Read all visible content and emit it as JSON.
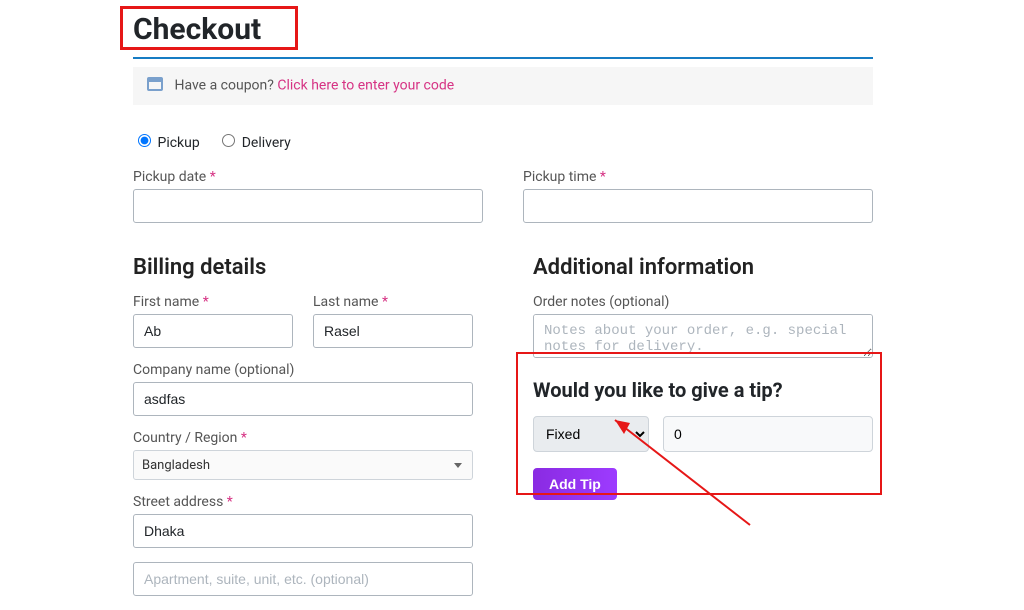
{
  "page": {
    "title": "Checkout"
  },
  "coupon": {
    "lead": "Have a coupon?",
    "link": "Click here to enter your code"
  },
  "selection": {
    "pickup_label": "Pickup",
    "delivery_label": "Delivery"
  },
  "schedule": {
    "pickup_date_label": "Pickup date",
    "pickup_time_label": "Pickup time",
    "pickup_date_value": "",
    "pickup_time_value": ""
  },
  "billing": {
    "heading": "Billing details",
    "first_name_label": "First name",
    "first_name_value": "Ab",
    "last_name_label": "Last name",
    "last_name_value": "Rasel",
    "company_label": "Company name (optional)",
    "company_value": "asdfas",
    "country_label": "Country / Region",
    "country_value": "Bangladesh",
    "street_label": "Street address",
    "street_value": "Dhaka",
    "apartment_placeholder": "Apartment, suite, unit, etc. (optional)",
    "apartment_value": ""
  },
  "additional": {
    "heading": "Additional information",
    "order_notes_label": "Order notes (optional)",
    "order_notes_placeholder": "Notes about your order, e.g. special notes for delivery.",
    "order_notes_value": ""
  },
  "tip": {
    "heading": "Would you like to give a tip?",
    "type_selected": "Fixed",
    "amount_value": "0",
    "button_label": "Add Tip"
  }
}
